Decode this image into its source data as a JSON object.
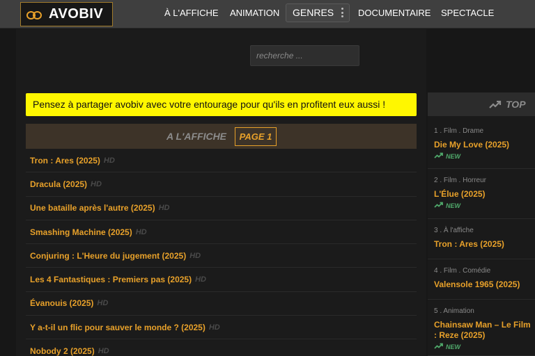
{
  "logo": {
    "text": "AVOBIV",
    "icon": "infinity-icon"
  },
  "nav": {
    "items": [
      "À L'AFFICHE",
      "ANIMATION",
      "DOCUMENTAIRE",
      "SPECTACLE"
    ],
    "genres": "GENRES"
  },
  "search": {
    "placeholder": "recherche ..."
  },
  "notice": "Pensez à partager avobiv avec votre entourage pour qu'ils en profitent eux aussi !",
  "section": {
    "label": "A L'AFFICHE",
    "page": "PAGE 1"
  },
  "list": [
    {
      "title": "Tron : Ares (2025)",
      "quality": "HD"
    },
    {
      "title": "Dracula (2025)",
      "quality": "HD"
    },
    {
      "title": "Une bataille après l'autre (2025)",
      "quality": "HD"
    },
    {
      "title": "Smashing Machine (2025)",
      "quality": "HD"
    },
    {
      "title": "Conjuring : L'Heure du jugement (2025)",
      "quality": "HD"
    },
    {
      "title": "Les 4 Fantastiques : Premiers pas (2025)",
      "quality": "HD"
    },
    {
      "title": "Évanouis (2025)",
      "quality": "HD"
    },
    {
      "title": "Y a-t-il un flic pour sauver le monde ? (2025)",
      "quality": "HD"
    },
    {
      "title": "Nobody 2 (2025)",
      "quality": "HD"
    }
  ],
  "sidebar": {
    "label": "TOP",
    "icon": "trending-up-icon",
    "items": [
      {
        "meta": "1 . Film . Drame",
        "title": "Die My Love (2025)",
        "badge": "NEW"
      },
      {
        "meta": "2 . Film . Horreur",
        "title": "L'Élue (2025)",
        "badge": "NEW"
      },
      {
        "meta": "3 . À l'affiche",
        "title": "Tron : Ares (2025)",
        "badge": ""
      },
      {
        "meta": "4 . Film . Comédie",
        "title": "Valensole 1965 (2025)",
        "badge": ""
      },
      {
        "meta": "5 . Animation",
        "title": "Chainsaw Man – Le Film : Reze (2025)",
        "badge": "NEW"
      }
    ]
  },
  "colors": {
    "accent": "#e8a12a",
    "notice_bg": "#fff700",
    "new": "#4fa86a"
  }
}
